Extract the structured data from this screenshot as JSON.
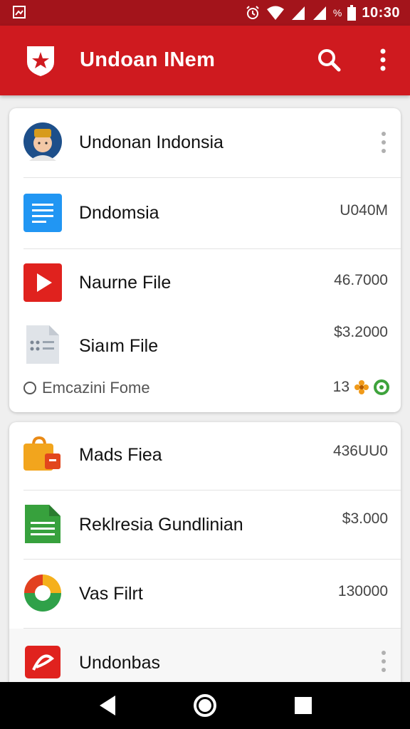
{
  "status_bar": {
    "time": "10:30",
    "battery_label": "%",
    "icons": [
      "notification-image-icon",
      "alarm-icon",
      "wifi-icon",
      "signal-icon",
      "battery-icon"
    ]
  },
  "app_bar": {
    "title": "Undoan INem",
    "icons": [
      "app-logo-icon",
      "search-icon",
      "overflow-menu-icon"
    ],
    "color": "#cf1a1f"
  },
  "card1": {
    "items": [
      {
        "label": "Undonan Indonsia",
        "value": "",
        "icon": "avatar"
      },
      {
        "label": "Dndomsia",
        "value": "U040M",
        "icon": "document-icon"
      },
      {
        "label": "Naurne File",
        "value": "46.7000",
        "icon": "play-icon"
      },
      {
        "label": "Siaım File",
        "value": "$3.2000",
        "icon": "file-icon"
      }
    ],
    "footer": {
      "label": "Emcazini Fome",
      "value": "13"
    }
  },
  "card2": {
    "items": [
      {
        "label": "Mads Fiea",
        "value": "436UU0",
        "icon": "shopping-bag-icon"
      },
      {
        "label": "Reklresia Gundlinian",
        "value": "$3.000",
        "icon": "sheet-icon"
      },
      {
        "label": "Vas Filrt",
        "value": "130000",
        "icon": "circle-logo-icon"
      },
      {
        "label": "Undonbas",
        "value": "",
        "icon": "red-app-icon"
      }
    ]
  },
  "nav_bar": {
    "icons": [
      "back-icon",
      "home-icon",
      "recents-icon"
    ]
  }
}
